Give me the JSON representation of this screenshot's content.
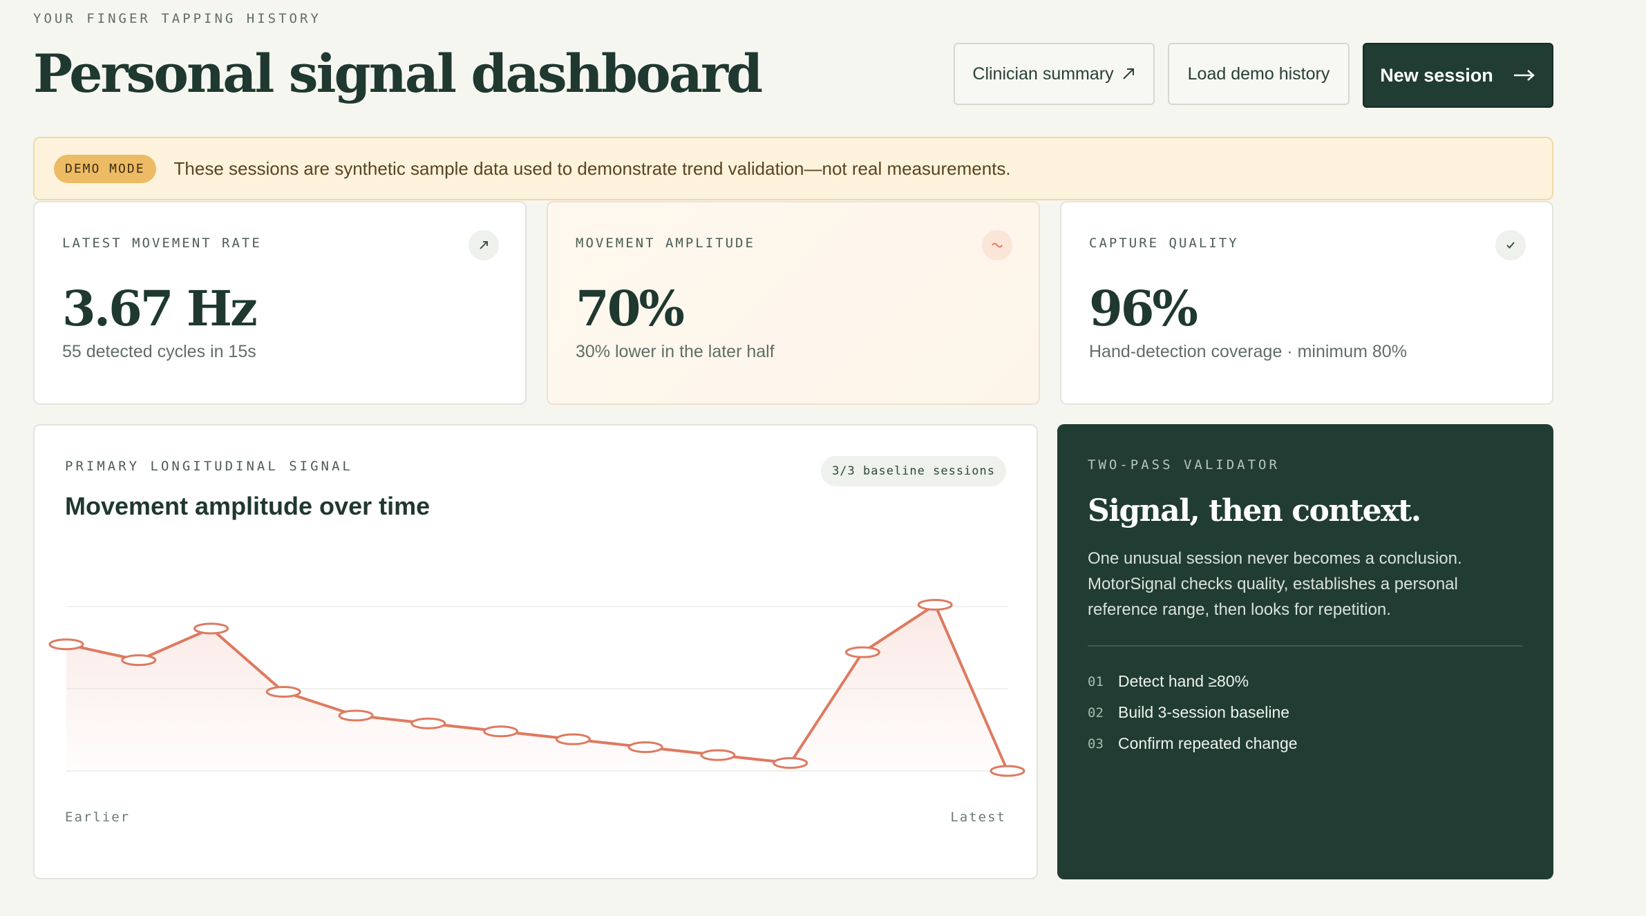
{
  "header": {
    "eyebrow": "YOUR FINGER TAPPING HISTORY",
    "title": "Personal signal dashboard"
  },
  "actions": {
    "clinician_label": "Clinician summary",
    "clinician_icon": "external-arrow-icon",
    "demo_label": "Load demo history",
    "new_label": "New session",
    "new_icon": "arrow-right-icon"
  },
  "banner": {
    "badge": "DEMO MODE",
    "text": "These sessions are synthetic sample data used to demonstrate trend validation—not real measurements."
  },
  "stats": [
    {
      "label": "LATEST MOVEMENT RATE",
      "icon": "trend-up-icon",
      "value": "3.67 Hz",
      "sub": "55 detected cycles in 15s"
    },
    {
      "label": "MOVEMENT AMPLITUDE",
      "icon": "wave-icon",
      "value": "70%",
      "sub": "30% lower in the later half"
    },
    {
      "label": "CAPTURE QUALITY",
      "icon": "check-icon",
      "value": "96%",
      "sub": "Hand-detection coverage · minimum 80%"
    }
  ],
  "chart": {
    "eyebrow": "PRIMARY LONGITUDINAL SIGNAL",
    "title": "Movement amplitude over time",
    "baseline_pill": "3/3 baseline sessions",
    "x_start_label": "Earlier",
    "x_end_label": "Latest",
    "line_color": "#dd7a61",
    "fill_color": "#f6d6cf"
  },
  "chart_data": {
    "type": "line",
    "title": "Movement amplitude over time",
    "xlabel": "",
    "ylabel": "",
    "x": [
      1,
      2,
      3,
      4,
      5,
      6,
      7,
      8,
      9,
      10,
      11,
      12,
      13,
      14
    ],
    "series": [
      {
        "values": [
          76,
          74,
          78,
          70,
          67,
          66,
          65,
          64,
          63,
          62,
          61,
          75,
          81,
          60
        ]
      }
    ],
    "ylim": [
      60,
      82
    ],
    "grid": true,
    "legend": "none"
  },
  "validator": {
    "eyebrow": "TWO-PASS VALIDATOR",
    "title": "Signal, then context.",
    "body": "One unusual session never becomes a conclusion. MotorSignal checks quality, establishes a personal reference range, then looks for repetition.",
    "steps": [
      {
        "num": "01",
        "text": "Detect hand ≥80%"
      },
      {
        "num": "02",
        "text": "Build 3-session baseline"
      },
      {
        "num": "03",
        "text": "Confirm repeated change"
      }
    ]
  }
}
